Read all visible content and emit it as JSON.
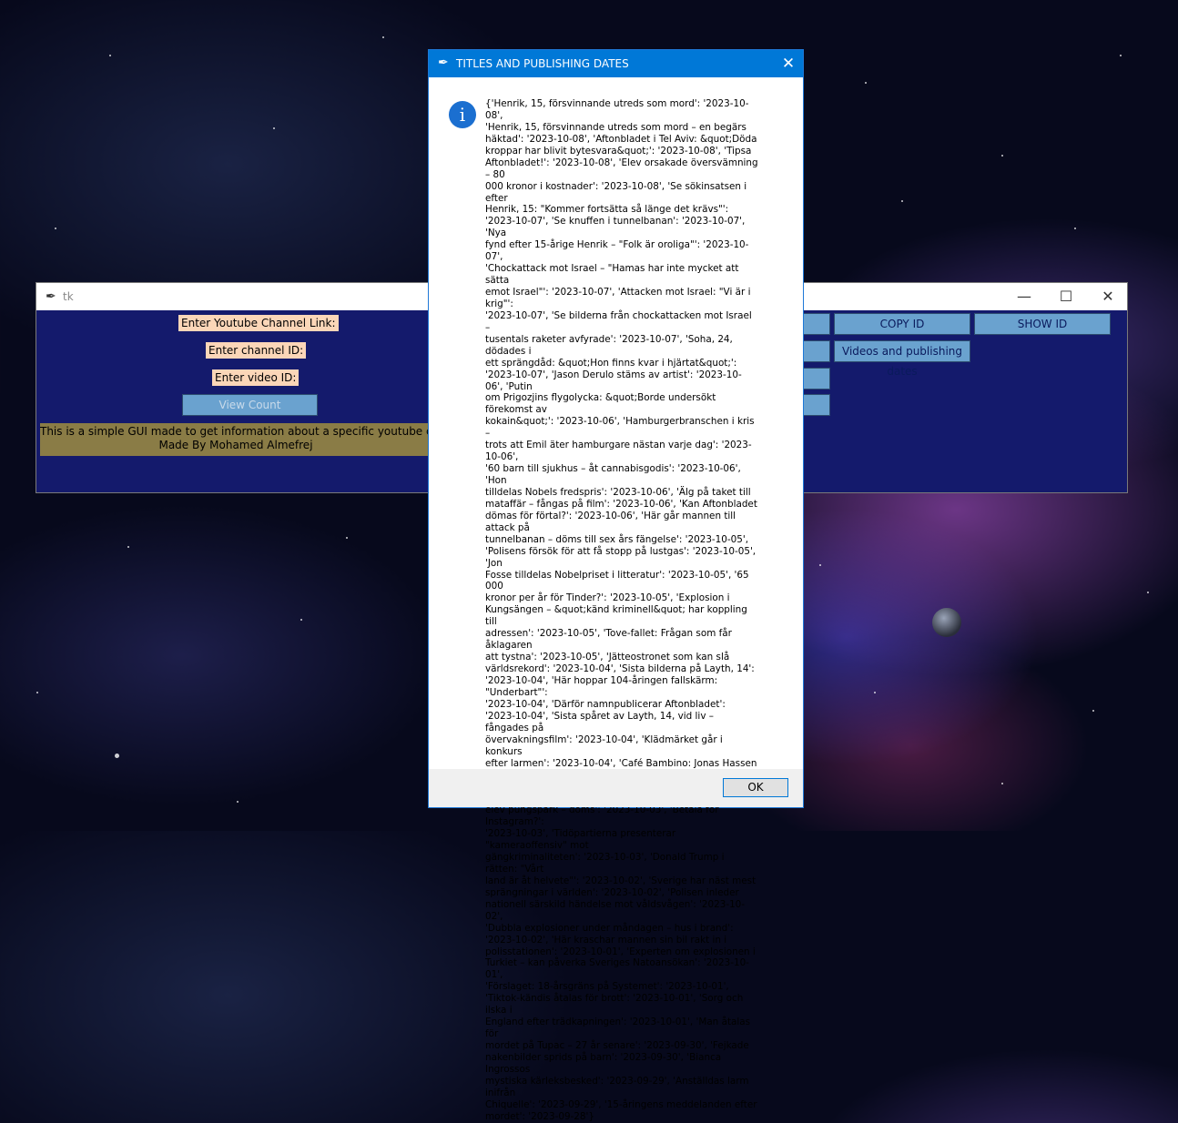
{
  "main_window": {
    "title": "tk",
    "controls": {
      "minimize": "—",
      "maximize": "☐",
      "close": "✕"
    },
    "labels": {
      "channel_link": "Enter Youtube Channel Link:",
      "channel_id": "Enter channel ID:",
      "video_id": "Enter video ID:"
    },
    "buttons": {
      "view_count": "View Count",
      "copy_id": "COPY ID",
      "show_id": "SHOW ID",
      "videos_dates": "Videos and publishing dates"
    },
    "info_line1": "This is a simple GUI made to get information about a specific youtube channel or",
    "info_line2": "Made By Mohamed Almefrej"
  },
  "dialog": {
    "title": "TITLES AND PUBLISHING DATES",
    "close": "✕",
    "icon": "i",
    "message_lines": [
      "{'Henrik, 15, försvinnande utreds som mord': '2023-10-08',",
      "'Henrik, 15, försvinnande utreds som mord – en begärs",
      "häktad': '2023-10-08', 'Aftonbladet i Tel Aviv: &quot;Döda",
      "kroppar har blivit bytesvara&quot;': '2023-10-08', 'Tipsa",
      "Aftonbladet!': '2023-10-08', 'Elev orsakade översvämning – 80",
      "000 kronor i kostnader': '2023-10-08', 'Se sökinsatsen i efter",
      "Henrik, 15: \"Kommer fortsätta så länge det krävs\"':",
      "'2023-10-07', 'Se knuffen i tunnelbanan': '2023-10-07', 'Nya",
      "fynd efter 15-årige Henrik – \"Folk är oroliga\"': '2023-10-07',",
      "'Chockattack mot Israel – \"Hamas har inte mycket att sätta",
      "emot Israel\"': '2023-10-07', 'Attacken mot Israel: \"Vi är i krig\"':",
      "'2023-10-07', 'Se bilderna från chockattacken mot Israel –",
      "tusentals raketer avfyrade': '2023-10-07', 'Soha, 24, dödades i",
      "ett sprängdåd: &quot;Hon finns kvar i hjärtat&quot;':",
      "'2023-10-07', 'Jason Derulo stäms av artist': '2023-10-06', 'Putin",
      "om Prigozjins flygolycka: &quot;Borde undersökt förekomst av",
      "kokain&quot;': '2023-10-06', 'Hamburgerbranschen i kris –",
      "trots att Emil äter hamburgare nästan varje dag': '2023-10-06',",
      "'60 barn till sjukhus – åt cannabisgodis': '2023-10-06', 'Hon",
      "tilldelas Nobels fredspris': '2023-10-06', 'Älg på taket till",
      "mataffär – fångas på film': '2023-10-06', 'Kan Aftonbladet",
      "dömas för förtal?': '2023-10-06', 'Här går mannen till attack på",
      "tunnelbanan – döms till sex års fängelse': '2023-10-05',",
      "'Polisens försök för att få stopp på lustgas': '2023-10-05', 'Jon",
      "Fosse tilldelas Nobelpriset i litteratur': '2023-10-05', '65 000",
      "kronor per år för Tinder?': '2023-10-05', 'Explosion i",
      "Kungsängen – &quot;känd kriminell&quot; har koppling till",
      "adressen': '2023-10-05', 'Tove-fallet: Frågan som får åklagaren",
      "att tystna': '2023-10-05', 'Jätteostronet som kan slå",
      "världsrekord': '2023-10-04', 'Sista bilderna på Layth, 14':",
      "'2023-10-04', 'Här hoppar 104-åringen fallskärm: \"Underbart\"':",
      "'2023-10-04', 'Därför namnpublicerar Aftonbladet':",
      "'2023-10-04', 'Sista spåret av Layth, 14, vid liv – fångades på",
      "övervakningsfilm': '2023-10-04', 'Klädmärket går i konkurs",
      "efter larmen': '2023-10-04', 'Café Bambino: Jonas Hassen",
      "Khemiris förbannelse': '2023-10-04', 'En man skjuten vid",
      "köpcentrer i Malmö: \"Förhör vittnen\"': '2023-10-03', 'Lärare gav",
      "elev pungspark – döms': '2023-10-03', 'Betala för Instagram?':",
      "'2023-10-03', 'Tidöpartierna presenterar \"kameraoffensiv\" mot",
      "gängkriminaliteten': '2023-10-03', 'Donald Trump i rätten: \"Vårt",
      "land är åt helvete\"': '2023-10-02', 'Sverige har näst mest",
      "sprängningar i världen': '2023-10-02', 'Polisen inleder",
      "nationell särskild händelse mot våldsvågen': '2023-10-02',",
      "'Dubbla explosioner under måndagen – hus i brand':",
      "'2023-10-02', 'Här kraschar mannen sin bil rakt in i",
      "polisstationen': '2023-10-01', 'Experten om explosionen i",
      "Turkiet – kan påverka Sveriges Natoansökan': '2023-10-01',",
      "'Förslaget: 18-årsgräns på Systemet': '2023-10-01',",
      "'Tiktok-kändis åtalas för brott': '2023-10-01', 'Sorg och ilska i",
      "England efter trädkapningen': '2023-10-01', 'Man åtalas för",
      "mordet på Tupac – 27 år senare': '2023-09-30', 'Fejkade",
      "nakenbilder sprids på barn': '2023-09-30', 'Bianca Ingrossos",
      "mystiska kärleksbesked': '2023-09-29', 'Anställdas larm inifrån",
      "Chiquelle': '2023-09-29', '15-åringens meddelanden efter",
      "mordet': '2023-09-28'}"
    ],
    "ok_label": "OK"
  }
}
